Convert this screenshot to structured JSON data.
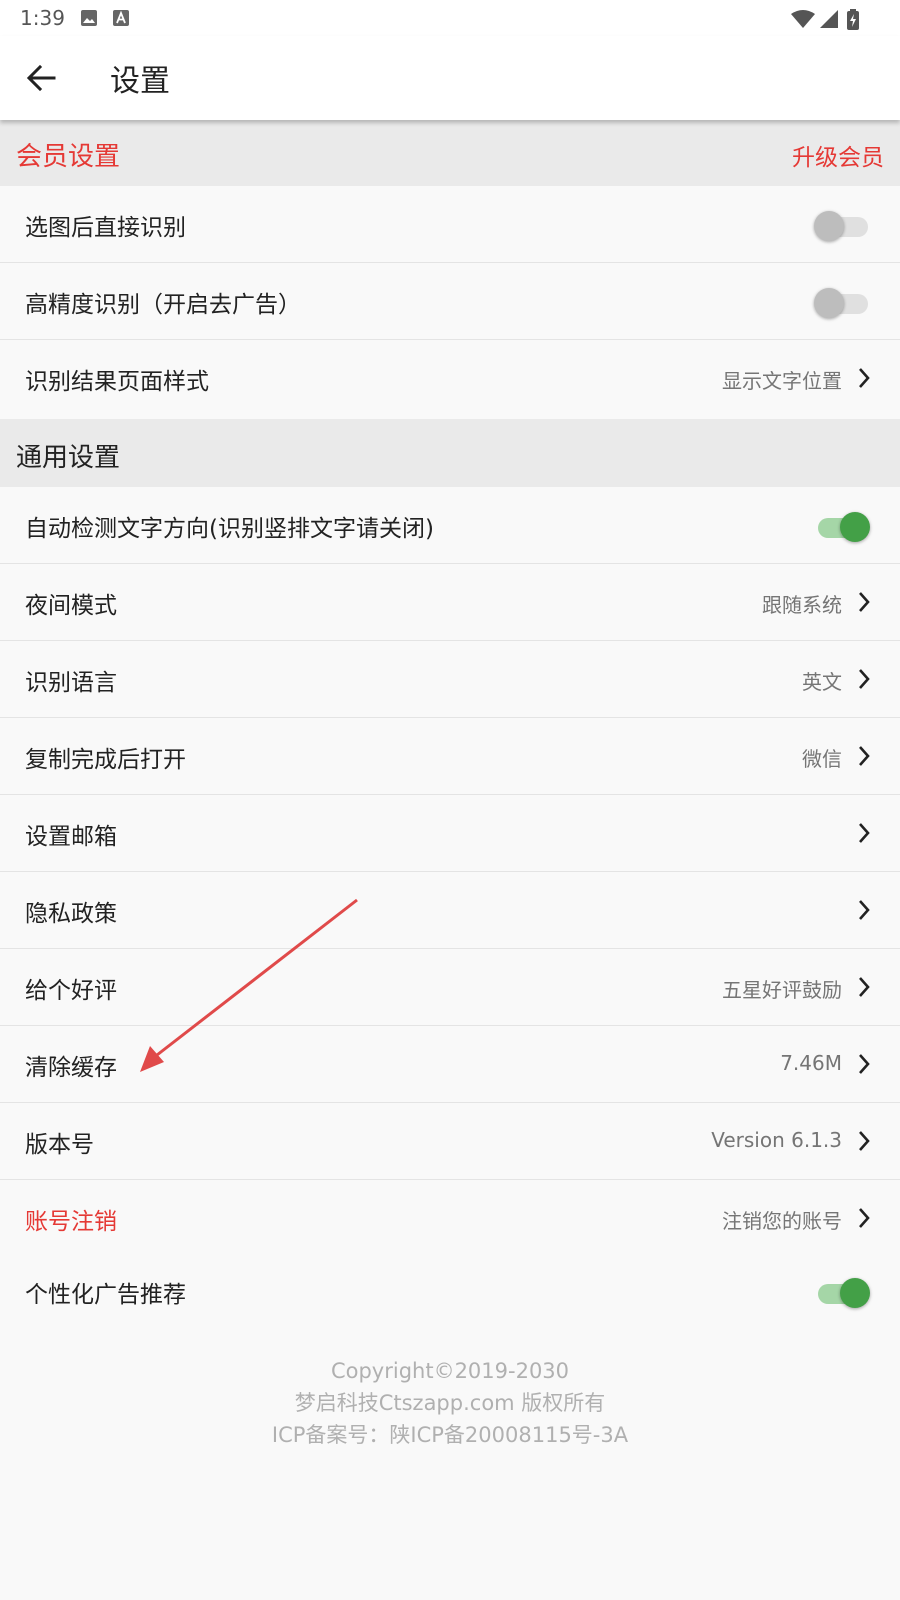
{
  "status_bar": {
    "time": "1:39",
    "icons": [
      "image-icon",
      "font-icon",
      "wifi-icon",
      "signal-icon",
      "battery-icon"
    ]
  },
  "app_bar": {
    "title": "设置",
    "back_icon": "arrow-back-icon"
  },
  "colors": {
    "accent_red": "#e53935",
    "switch_on": "#43a047",
    "annotation_arrow": "#e04a4a"
  },
  "member_section": {
    "title": "会员设置",
    "action": "升级会员",
    "items": [
      {
        "label": "选图后直接识别",
        "type": "switch",
        "on": false
      },
      {
        "label": "高精度识别（开启去广告）",
        "type": "switch",
        "on": false
      },
      {
        "label": "识别结果页面样式",
        "type": "link",
        "value": "显示文字位置"
      }
    ]
  },
  "general_section": {
    "title": "通用设置",
    "items": [
      {
        "label": "自动检测文字方向(识别竖排文字请关闭)",
        "type": "switch",
        "on": true
      },
      {
        "label": "夜间模式",
        "type": "link",
        "value": "跟随系统"
      },
      {
        "label": "识别语言",
        "type": "link",
        "value": "英文"
      },
      {
        "label": "复制完成后打开",
        "type": "link",
        "value": "微信"
      },
      {
        "label": "设置邮箱",
        "type": "link",
        "value": ""
      },
      {
        "label": "隐私政策",
        "type": "link",
        "value": ""
      },
      {
        "label": "给个好评",
        "type": "link",
        "value": "五星好评鼓励"
      },
      {
        "label": "清除缓存",
        "type": "link",
        "value": "7.46M"
      },
      {
        "label": "版本号",
        "type": "link",
        "value": "Version 6.1.3"
      },
      {
        "label": "账号注销",
        "type": "link",
        "value": "注销您的账号"
      },
      {
        "label": "个性化广告推荐",
        "type": "switch",
        "on": true
      }
    ]
  },
  "footer": {
    "line1": "Copyright©2019-2030",
    "line2": "梦启科技Ctszapp.com 版权所有",
    "line3": "ICP备案号：陕ICP备20008115号-3A"
  }
}
